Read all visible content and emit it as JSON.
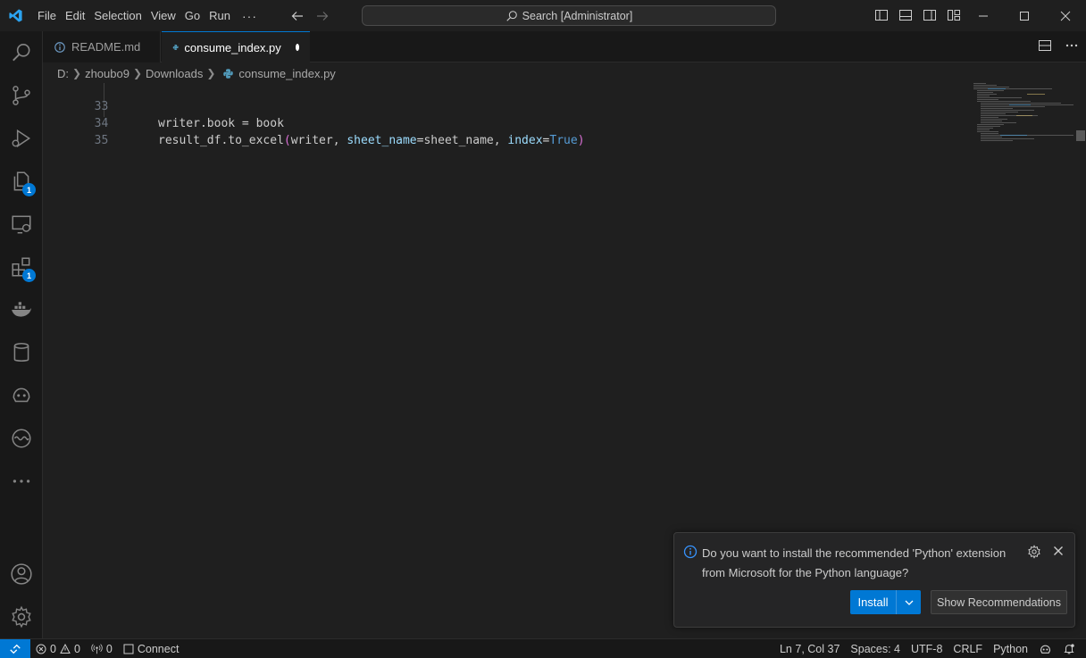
{
  "titlebar": {
    "app_icon": "vscode-logo-icon",
    "menu": [
      "File",
      "Edit",
      "Selection",
      "View",
      "Go",
      "Run"
    ],
    "more_label": "···",
    "search_text": "Search [Administrator]"
  },
  "tabs": [
    {
      "label": "README.md",
      "icon": "info-icon",
      "active": false
    },
    {
      "label": "consume_index.py",
      "icon": "python-icon",
      "active": true,
      "dirty": true
    }
  ],
  "breadcrumb": [
    "D:",
    "zhoubo9",
    "Downloads",
    "consume_index.py"
  ],
  "editor": {
    "lines": [
      {
        "number": "33"
      },
      {
        "number": "34"
      },
      {
        "number": "35"
      }
    ],
    "line33": {
      "var": "writer",
      "dot1": ".book = ",
      "rhs": "book"
    },
    "line34": {
      "obj": "result_df",
      "method": ".to_excel",
      "open": "(",
      "arg1": "writer",
      "sep1": ", ",
      "param1": "sheet_name",
      "eq1": "=",
      "val1": "sheet_name",
      "sep2": ", ",
      "param2": "index",
      "eq2": "=",
      "val2": "True",
      "close": ")"
    }
  },
  "activity_badges": {
    "explorer": "1",
    "extensions": "1"
  },
  "notification": {
    "message": "Do you want to install the recommended 'Python' extension from Microsoft for the Python language?",
    "install_label": "Install",
    "recommendations_label": "Show Recommendations"
  },
  "statusbar": {
    "errors": "0",
    "warnings": "0",
    "ports": "0",
    "connect": "Connect",
    "cursor": "Ln 7, Col 37",
    "spaces": "Spaces: 4",
    "encoding": "UTF-8",
    "eol": "CRLF",
    "language": "Python"
  },
  "colors": {
    "accent": "#0078d4",
    "background": "#1f1f1f"
  }
}
